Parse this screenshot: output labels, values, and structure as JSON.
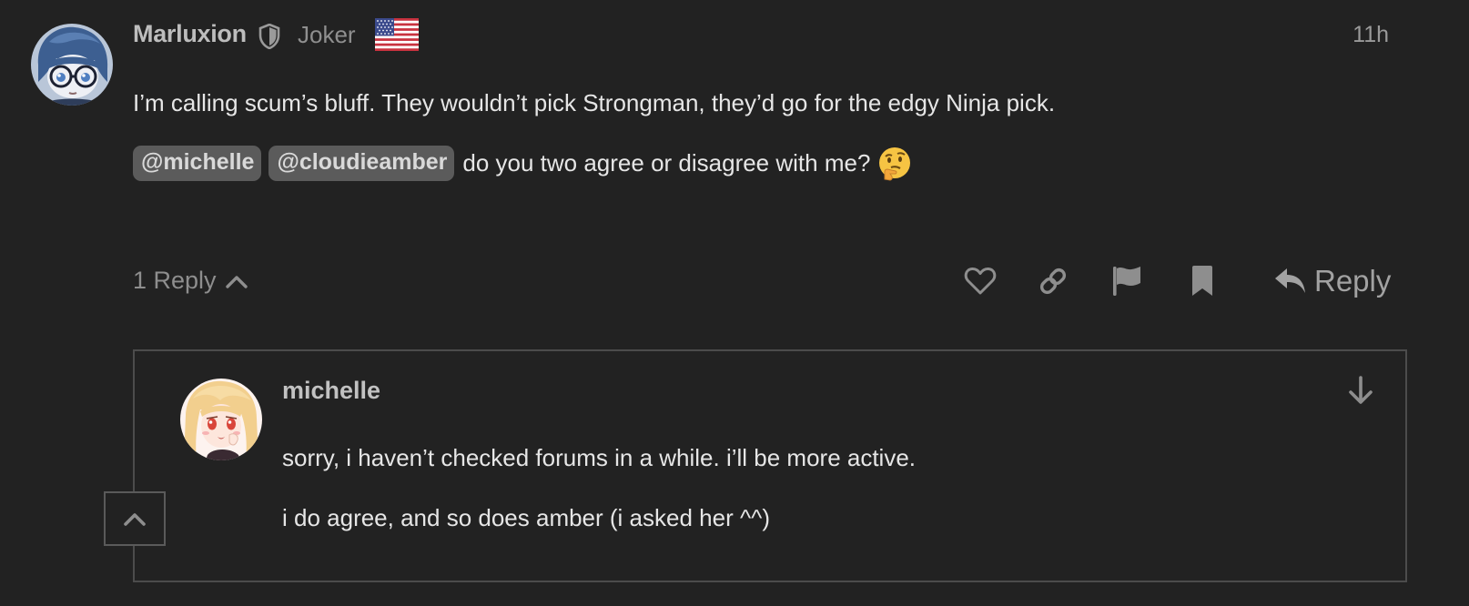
{
  "post": {
    "username": "Marluxion",
    "user_title": "Joker",
    "time": "11h",
    "paragraph1": "I’m calling scum’s bluff. They wouldn’t pick Strongman, they’d go for the edgy Ninja pick.",
    "mentions": [
      "@michelle",
      "@cloudieamber"
    ],
    "paragraph2": "do you two agree or disagree with me?",
    "emoji": "thinking-face",
    "avatar": "avatar-blue-hair-glasses",
    "flag": "us-flag-icon",
    "badge": "shield-icon"
  },
  "controls": {
    "replies_toggle": "1 Reply",
    "reply_button": "Reply",
    "actions": [
      "like-icon",
      "share-link-icon",
      "flag-icon",
      "bookmark-icon"
    ]
  },
  "embedded_reply": {
    "username": "michelle",
    "line1": "sorry, i haven’t checked forums in a while. i’ll be more active.",
    "line2": "i do agree, and so does amber (i asked her ^^)",
    "avatar": "avatar-blonde-anime-girl",
    "jump_icon": "arrow-down-icon",
    "collapse_icon": "chevron-up-icon"
  },
  "colors": {
    "background": "#222222",
    "mention_bg": "#5b5b5b",
    "border": "#4c4c4c",
    "muted_text": "#8e8e8e"
  }
}
